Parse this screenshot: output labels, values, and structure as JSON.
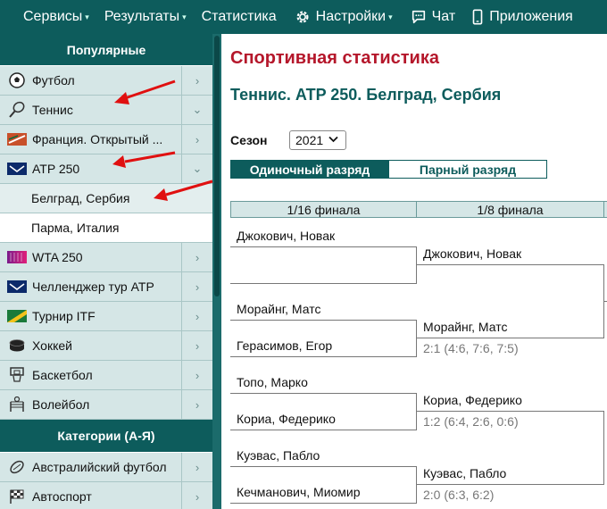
{
  "nav": {
    "items": [
      {
        "label": "Сервисы",
        "caret": "▾"
      },
      {
        "label": "Результаты",
        "caret": "▾"
      },
      {
        "label": "Статистика",
        "caret": ""
      },
      {
        "label": "Настройки",
        "caret": "▾",
        "icon": "gear-icon"
      },
      {
        "label": "Чат",
        "caret": "",
        "icon": "chat-icon"
      },
      {
        "label": "Приложения",
        "caret": "",
        "icon": "phone-icon"
      }
    ]
  },
  "sidebar": {
    "popular_header": "Популярные",
    "items": [
      {
        "label": "Футбол",
        "icon": "soccer-ball-icon",
        "arrow": "›"
      },
      {
        "label": "Теннис",
        "icon": "tennis-racket-icon",
        "arrow": "⌄"
      },
      {
        "label": "Франция. Открытый ...",
        "icon": "roland-garros-icon",
        "arrow": "›"
      },
      {
        "label": "ATP 250",
        "icon": "atp-logo-icon",
        "arrow": "⌄"
      },
      {
        "label": "Белград, Сербия",
        "icon": "",
        "arrow": ""
      },
      {
        "label": "Парма, Италия",
        "icon": "",
        "arrow": ""
      },
      {
        "label": "WTA 250",
        "icon": "wta-logo-icon",
        "arrow": "›"
      },
      {
        "label": "Челленджер тур ATP",
        "icon": "atp-challenger-icon",
        "arrow": "›"
      },
      {
        "label": "Турнир ITF",
        "icon": "itf-logo-icon",
        "arrow": "›"
      },
      {
        "label": "Хоккей",
        "icon": "hockey-puck-icon",
        "arrow": "›"
      },
      {
        "label": "Баскетбол",
        "icon": "basketball-icon",
        "arrow": "›"
      },
      {
        "label": "Волейбол",
        "icon": "volleyball-icon",
        "arrow": "›"
      }
    ],
    "categories_header": "Категории (А-Я)",
    "categories": [
      {
        "label": "Австралийский футбол",
        "icon": "aussie-football-icon",
        "arrow": "›"
      },
      {
        "label": "Автоспорт",
        "icon": "checkered-flag-icon",
        "arrow": "›"
      }
    ]
  },
  "main": {
    "title": "Спортивная статистика",
    "subtitle": "Теннис. ATP 250. Белград, Сербия",
    "season_label": "Сезон",
    "season_value": "2021",
    "tab_singles": "Одиночный разряд",
    "tab_doubles": "Парный разряд",
    "round_1": "1/16 финала",
    "round_2": "1/8 финала"
  },
  "bracket": {
    "r1": [
      "Джокович, Новак",
      "",
      "Морайнг, Матс",
      "Герасимов, Егор",
      "Топо, Марко",
      "Кориа, Федерико",
      "Куэвас, Пабло",
      "Кечманович, Миомир"
    ],
    "r2": [
      {
        "player": "Джокович, Новак",
        "score": ""
      },
      {
        "player": "Морайнг, Матс",
        "score": "2:1 (4:6, 7:6, 7:5)"
      },
      {
        "player": "Кориа, Федерико",
        "score": "1:2 (6:4, 2:6, 0:6)"
      },
      {
        "player": "Куэвас, Пабло",
        "score": "2:0 (6:3, 6:2)"
      }
    ]
  },
  "colors": {
    "nav_bg": "#0d5c5c",
    "title_red": "#b5172b",
    "arrow_red": "#e01010"
  }
}
